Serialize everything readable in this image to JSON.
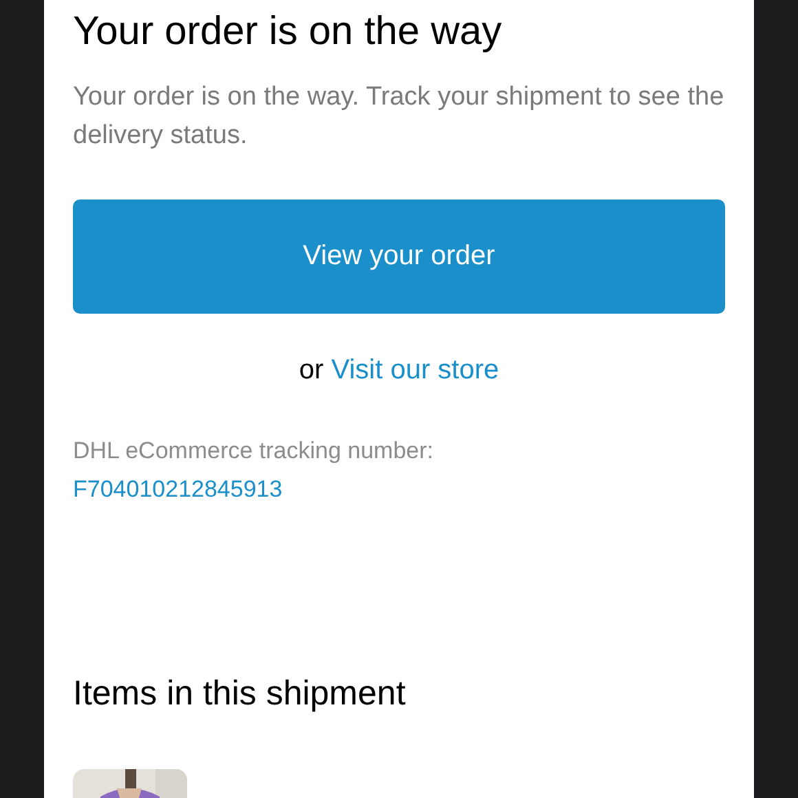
{
  "heading": "Your order is on the way",
  "message": "Your order is on the way. Track your shipment to see the delivery status.",
  "primary_button": "View your order",
  "secondary": {
    "prefix": "or",
    "link": "Visit our store"
  },
  "tracking": {
    "label": "DHL eCommerce tracking number:",
    "number": "F704010212845913"
  },
  "items_heading": "Items in this shipment"
}
